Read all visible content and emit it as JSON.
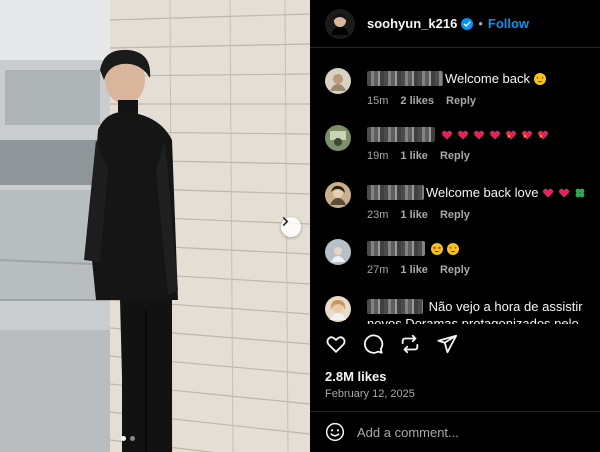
{
  "post": {
    "username": "soohyun_k216",
    "separator": "•",
    "follow_label": "Follow",
    "likes_count": "2.8M likes",
    "date": "February 12, 2025",
    "carousel": {
      "slide_count": 2,
      "active_index": 0
    }
  },
  "comments": [
    {
      "text": "Welcome back",
      "emojis": [
        "heart-eyes"
      ],
      "time": "15m",
      "likes": "2 likes",
      "reply": "Reply"
    },
    {
      "text": "",
      "emojis": [
        "red-heart",
        "red-heart",
        "red-heart",
        "red-heart",
        "heart-on-fire",
        "heart-on-fire",
        "heart-on-fire"
      ],
      "time": "19m",
      "likes": "1 like",
      "reply": "Reply"
    },
    {
      "text": "Welcome back love",
      "emojis": [
        "red-heart",
        "red-heart",
        "four-leaf-clover"
      ],
      "time": "23m",
      "likes": "1 like",
      "reply": "Reply"
    },
    {
      "text": "",
      "emojis": [
        "star-struck",
        "heart-eyes"
      ],
      "time": "27m",
      "likes": "1 like",
      "reply": "Reply"
    },
    {
      "text": "Não vejo a hora de assistir novos Doramas protagonizados pelo divo!!! Justiça",
      "emojis": [],
      "time": "",
      "likes": "",
      "reply": ""
    }
  ],
  "composer": {
    "placeholder": "Add a comment..."
  },
  "colors": {
    "accent": "#0095f6",
    "background": "#000000",
    "text": "#f5f5f5",
    "muted": "#a8a8a8",
    "emoji_red": "#e0245e"
  },
  "icons": [
    "verified-badge-icon",
    "heart-icon",
    "comment-icon",
    "repost-icon",
    "share-icon",
    "emoji-icon",
    "chevron-right-icon"
  ]
}
